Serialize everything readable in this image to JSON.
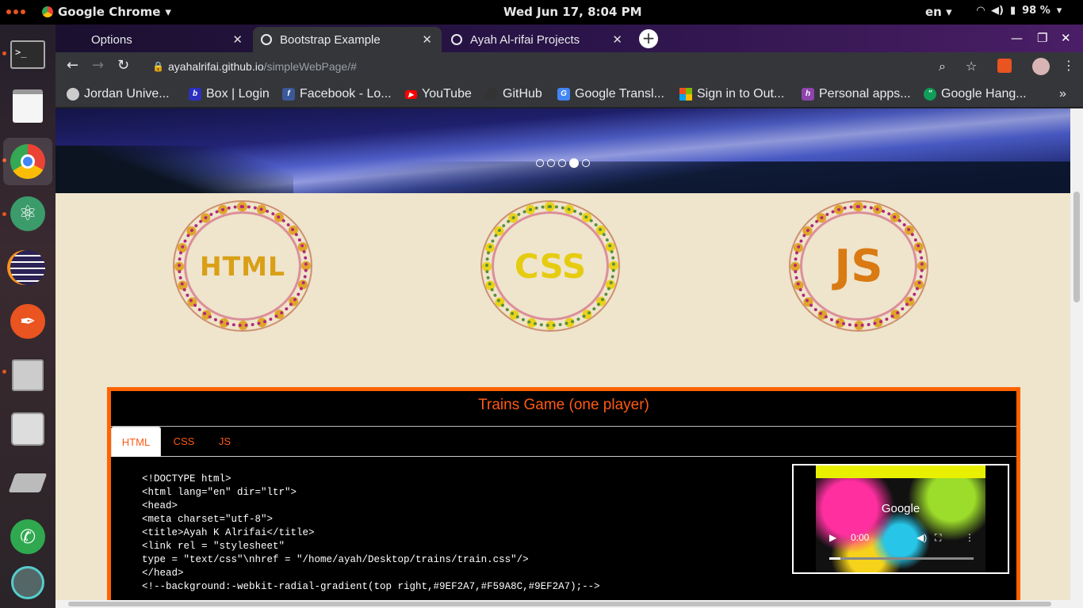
{
  "system": {
    "app_name": "Google Chrome",
    "clock": "Wed Jun 17,  8:04 PM",
    "language": "en",
    "battery": "98 %"
  },
  "browser": {
    "tabs": [
      {
        "title": "Options"
      },
      {
        "title": "Bootstrap Example"
      },
      {
        "title": "Ayah Al-rifai Projects"
      }
    ],
    "url_host": "ayahalrifai.github.io",
    "url_path": "/simpleWebPage/#",
    "bookmarks": [
      {
        "label": "Jordan Unive..."
      },
      {
        "label": "Box | Login"
      },
      {
        "label": "Facebook - Lo..."
      },
      {
        "label": "YouTube"
      },
      {
        "label": "GitHub"
      },
      {
        "label": "Google Transl..."
      },
      {
        "label": "Sign in to Out..."
      },
      {
        "label": "Personal apps..."
      },
      {
        "label": "Google Hang..."
      }
    ]
  },
  "page": {
    "carousel_active_index": 3,
    "carousel_count": 5,
    "skills": [
      {
        "label": "HTML",
        "color": "#d9a017"
      },
      {
        "label": "CSS",
        "color": "#e6cc10"
      },
      {
        "label": "JS",
        "color": "#d97a12"
      }
    ],
    "project": {
      "title": "Trains Game (one player)",
      "tabs": [
        "HTML",
        "CSS",
        "JS"
      ],
      "active_tab": "HTML",
      "code": "<!DOCTYPE html>\n<html lang=\"en\" dir=\"ltr\">\n<head>\n<meta charset=\"utf-8\">\n<title>Ayah K Alrifai</title>\n<link rel = \"stylesheet\"\ntype = \"text/css\"\\nhref = \"/home/ayah/Desktop/trains/train.css\"/>\n</head>\n<!--background:-webkit-radial-gradient(top right,#9EF2A7,#F59A8C,#9EF2A7);-->",
      "video": {
        "time": "0:00",
        "logo_text": "Google"
      }
    }
  }
}
